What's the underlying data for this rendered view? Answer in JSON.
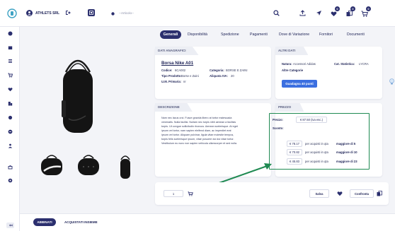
{
  "header": {
    "brand": "ATHLETS SRL",
    "search_placeholder": "--Articolo--",
    "badges": [
      "0",
      "0",
      "0"
    ]
  },
  "tabs": [
    {
      "label": "Generali",
      "active": true
    },
    {
      "label": "Disponibilità"
    },
    {
      "label": "Spedizione"
    },
    {
      "label": "Pagamenti"
    },
    {
      "label": "Dove di Variazione"
    },
    {
      "label": "Fornitori"
    },
    {
      "label": "Documenti"
    }
  ],
  "dati_anagrafici": {
    "section_title": "DATI ANAGRAFICI",
    "product_name": "Borsa Nike A01",
    "codice_label": "Codice:",
    "codice": "6CA002",
    "categoria_label": "Categoria:",
    "categoria": "BORSE E ZAINI",
    "tipo_label": "Tipo Prodotto:",
    "tipo": "Borse e Zaini",
    "aliquota_label": "Aliquota IVA:",
    "aliquota": "20",
    "um_label": "U.M. Primaria:",
    "um": "nr"
  },
  "altri_dati": {
    "section_title": "ALTRI DATI",
    "natura_label": "Natura:",
    "natura": "Accessori Adidas",
    "statistica_label": "Cat. Statistica:",
    "statistica": "LYCRA",
    "altre_categorie": "Altre Categorie",
    "button": "Guadagna 40 punti"
  },
  "descrizione": {
    "section_title": "DESCRIZIONE",
    "lines": [
      "Nam nec lacus orci. Fusce gravida libero at tortor malesuada",
      "venenatis. Nulla facilisi. Nullam nec turpis nibh aenean a facilisis",
      "turpis. Ut congue sollicitudin rhoncus. Aenean scelerisque. At eget",
      "ipsum vel tortor, nam sapien eleifend diam, ac imperdiet erat",
      "ipsum vel tortor. Aliquam pulvinar, ligula vitae molestie tempus,",
      "turpis felis scelerisque ipsum, vitae posuere dui dui vitae tortor.",
      "Vestibulum eu nunc non sapien vehicula ullamcorper et sed nulla."
    ]
  },
  "prezzo": {
    "section_title": "PREZZO",
    "prezzo_label": "Prezzo:",
    "prezzo_value": "€ 87.50 (iva esc.)",
    "sconto_label": "Sconto:",
    "tiers": [
      {
        "price": "€ 78.17",
        "text": "per acquisti in qta",
        "rule": "maggiore di 5"
      },
      {
        "price": "€ 70.82",
        "text": "per acquisti in qta",
        "rule": "maggiore di 10"
      },
      {
        "price": "€ 45.83",
        "text": "per acquisti in qta",
        "rule": "maggiore di 23"
      }
    ]
  },
  "cart": {
    "qty": "1",
    "salva": "Salva",
    "confronta": "Confronta"
  },
  "bottom_tabs": {
    "abbinati": "ABBINATI",
    "acquistati": "ACQUISTATI INSIEME"
  },
  "colors": {
    "navy": "#2b2f6e",
    "blue": "#3b6fe0",
    "green": "#1f8a52"
  }
}
